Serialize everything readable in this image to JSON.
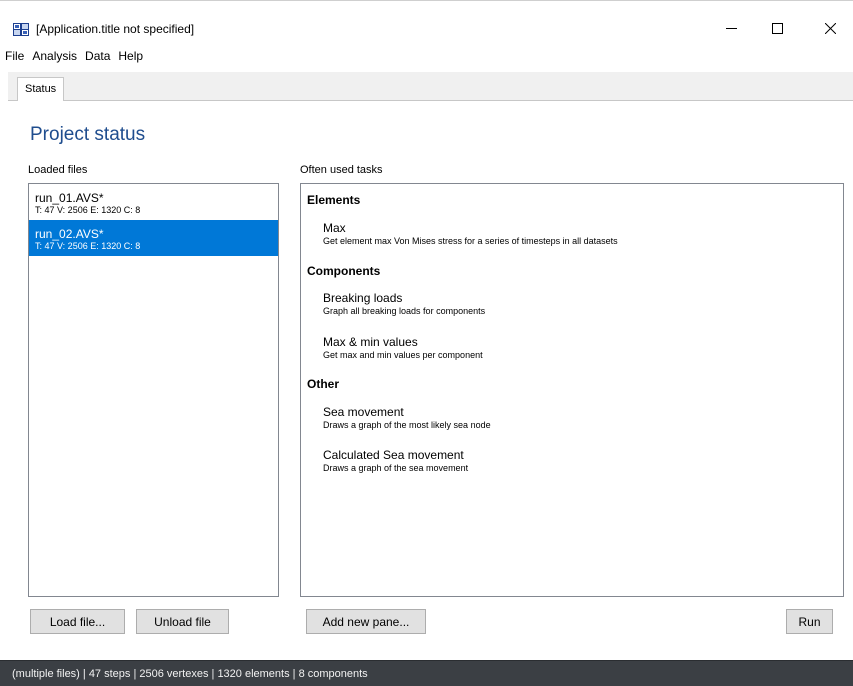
{
  "window": {
    "title": "[Application.title not specified]",
    "icon": "app-flag-icon",
    "controls": {
      "minimize": "minimize-icon",
      "maximize": "maximize-icon",
      "close": "close-icon"
    }
  },
  "menu": {
    "items": [
      "File",
      "Analysis",
      "Data",
      "Help"
    ]
  },
  "tabs": [
    {
      "label": "Status",
      "active": true
    }
  ],
  "main": {
    "title": "Project status",
    "loaded_files_label": "Loaded files",
    "tasks_label": "Often used tasks"
  },
  "files": [
    {
      "name": "run_01.AVS*",
      "meta": "T: 47 V: 2506 E: 1320 C: 8",
      "selected": false
    },
    {
      "name": "run_02.AVS*",
      "meta": "T: 47 V: 2506 E: 1320 C: 8",
      "selected": true
    }
  ],
  "task_groups": [
    {
      "heading": "Elements",
      "tasks": [
        {
          "name": "Max",
          "description": "Get element max Von Mises stress for a series of timesteps in all datasets"
        }
      ]
    },
    {
      "heading": "Components",
      "tasks": [
        {
          "name": "Breaking loads",
          "description": "Graph all breaking loads for components"
        },
        {
          "name": "Max & min values",
          "description": "Get max and min values per component"
        }
      ]
    },
    {
      "heading": "Other",
      "tasks": [
        {
          "name": "Sea movement",
          "description": "Draws a graph of the most likely sea node"
        },
        {
          "name": "Calculated Sea movement",
          "description": "Draws a graph of the sea movement"
        }
      ]
    }
  ],
  "buttons": {
    "load_file": "Load file...",
    "unload_file": "Unload file",
    "add_new_pane": "Add new pane...",
    "run": "Run"
  },
  "status_bar": {
    "text": "(multiple files) | 47 steps | 2506 vertexes | 1320 elements | 8 components"
  },
  "colors": {
    "accent": "#0078d7",
    "title": "#1f4d8e",
    "status_bar": "#3b3f44"
  }
}
